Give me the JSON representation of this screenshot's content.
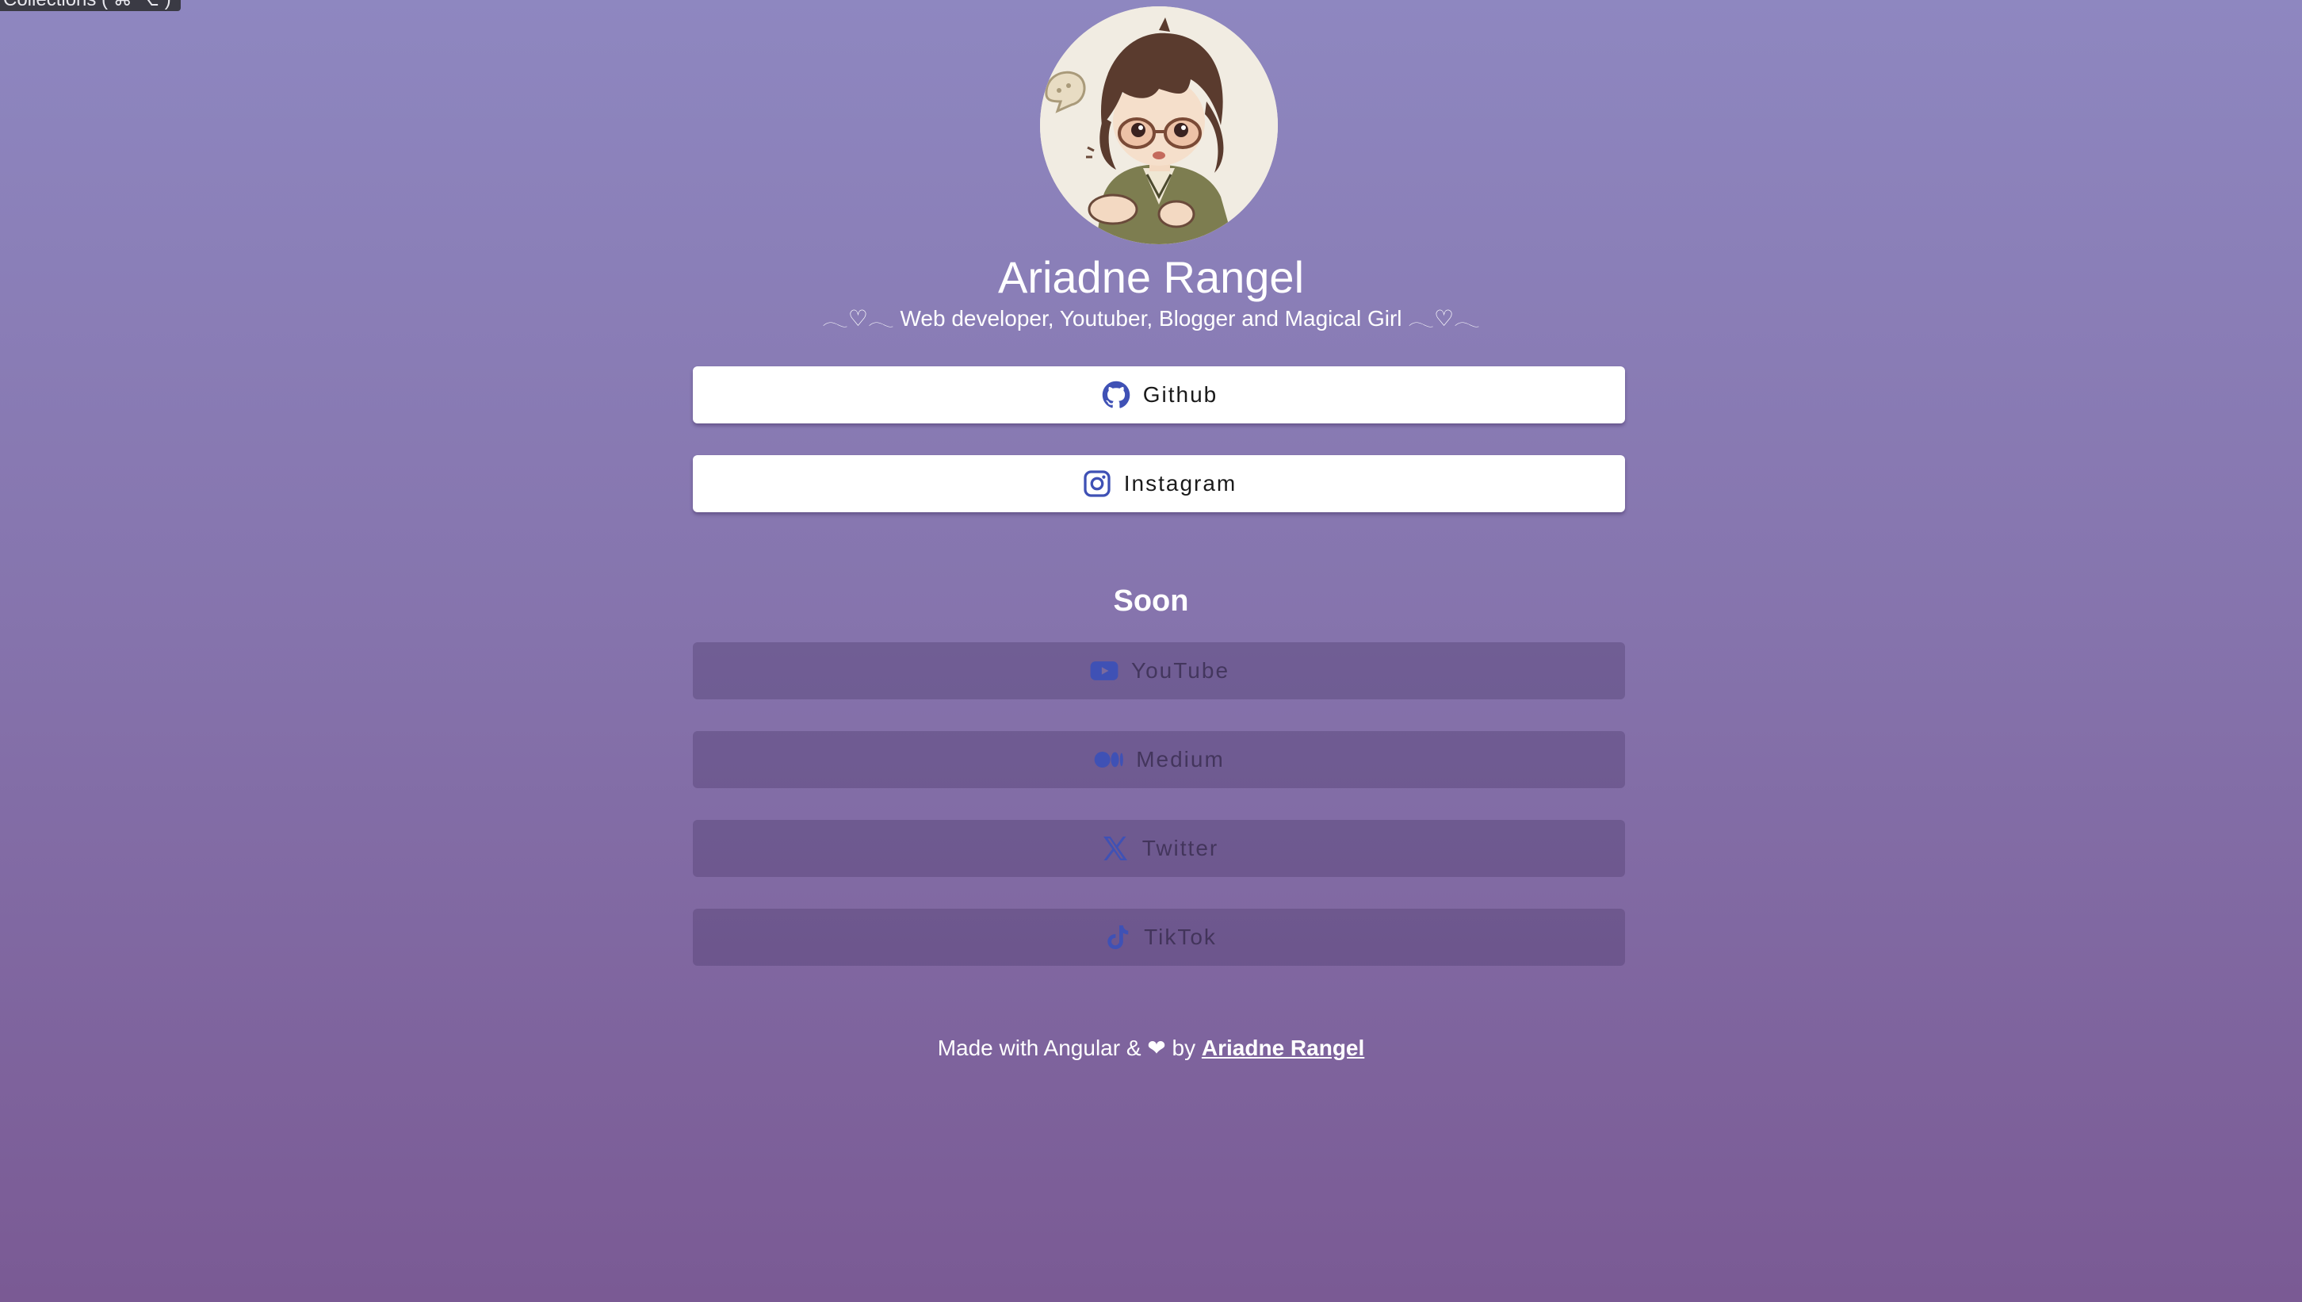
{
  "tooltip": {
    "text": "Collections ( ⌘ ⌥ )"
  },
  "profile": {
    "name": "Ariadne Rangel",
    "bio": "𓂃♡𓂃 Web developer, Youtuber, Blogger and Magical Girl 𓂃♡𓂃"
  },
  "links": [
    {
      "label": "Github",
      "icon": "github-icon"
    },
    {
      "label": "Instagram",
      "icon": "instagram-icon"
    }
  ],
  "soon": {
    "heading": "Soon",
    "items": [
      {
        "label": "YouTube",
        "icon": "youtube-icon"
      },
      {
        "label": "Medium",
        "icon": "medium-icon"
      },
      {
        "label": "Twitter",
        "icon": "x-icon"
      },
      {
        "label": "TikTok",
        "icon": "tiktok-icon"
      }
    ]
  },
  "footer": {
    "prefix": "Made with Angular & ❤ by ",
    "author_link": "Ariadne Rangel"
  },
  "colors": {
    "icon_blue": "#3f51b5",
    "bg_top": "#8e87c0",
    "bg_bottom": "#7a5a94"
  }
}
